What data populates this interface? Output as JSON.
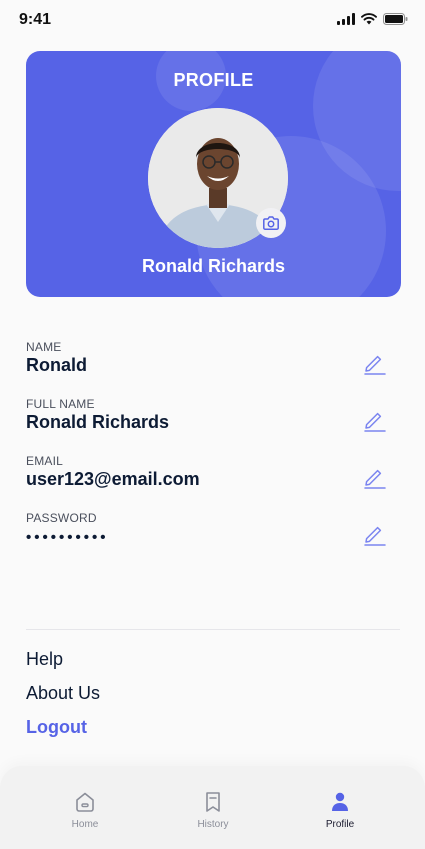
{
  "status_bar": {
    "time": "9:41"
  },
  "profile_card": {
    "title": "PROFILE",
    "name": "Ronald Richards",
    "accent_color": "#5663e6"
  },
  "fields": [
    {
      "label": "NAME",
      "value": "Ronald"
    },
    {
      "label": "FULL NAME",
      "value": "Ronald Richards"
    },
    {
      "label": "EMAIL",
      "value": "user123@email.com"
    },
    {
      "label": "PASSWORD",
      "value": "••••••••••"
    }
  ],
  "links": {
    "help": "Help",
    "about": "About Us",
    "logout": "Logout"
  },
  "nav": {
    "items": [
      {
        "label": "Home",
        "icon": "home-icon"
      },
      {
        "label": "History",
        "icon": "bookmark-icon"
      },
      {
        "label": "Profile",
        "icon": "person-icon",
        "active": true
      }
    ]
  }
}
